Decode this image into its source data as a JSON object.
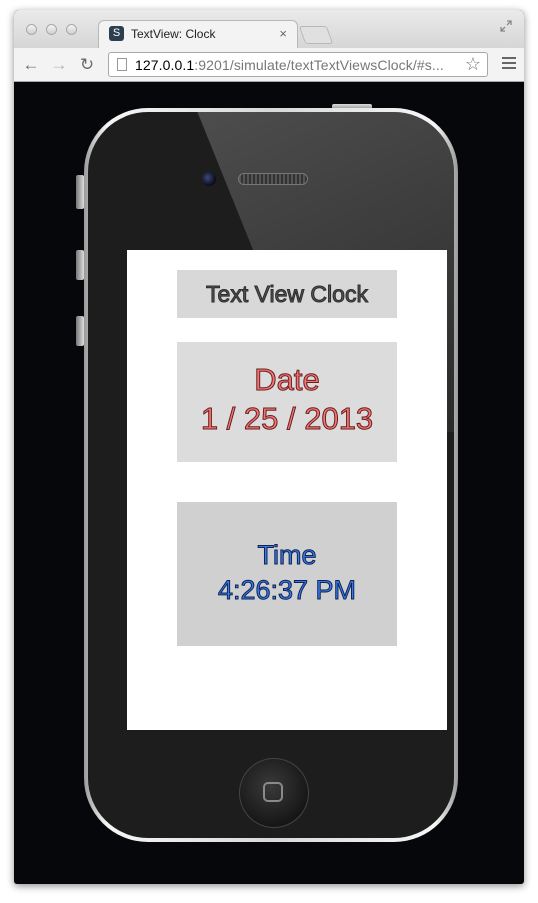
{
  "browser": {
    "tab_title": "TextView: Clock",
    "url_host": "127.0.0.1",
    "url_rest": ":9201/simulate/textTextViewsClock/#s..."
  },
  "app": {
    "title": "Text View Clock",
    "date_label": "Date",
    "date_value": "1 / 25 / 2013",
    "time_label": "Time",
    "time_value": "4:26:37 PM"
  },
  "colors": {
    "date_text": "#f07676",
    "time_text": "#3b78ee",
    "title_text": "#545454"
  }
}
